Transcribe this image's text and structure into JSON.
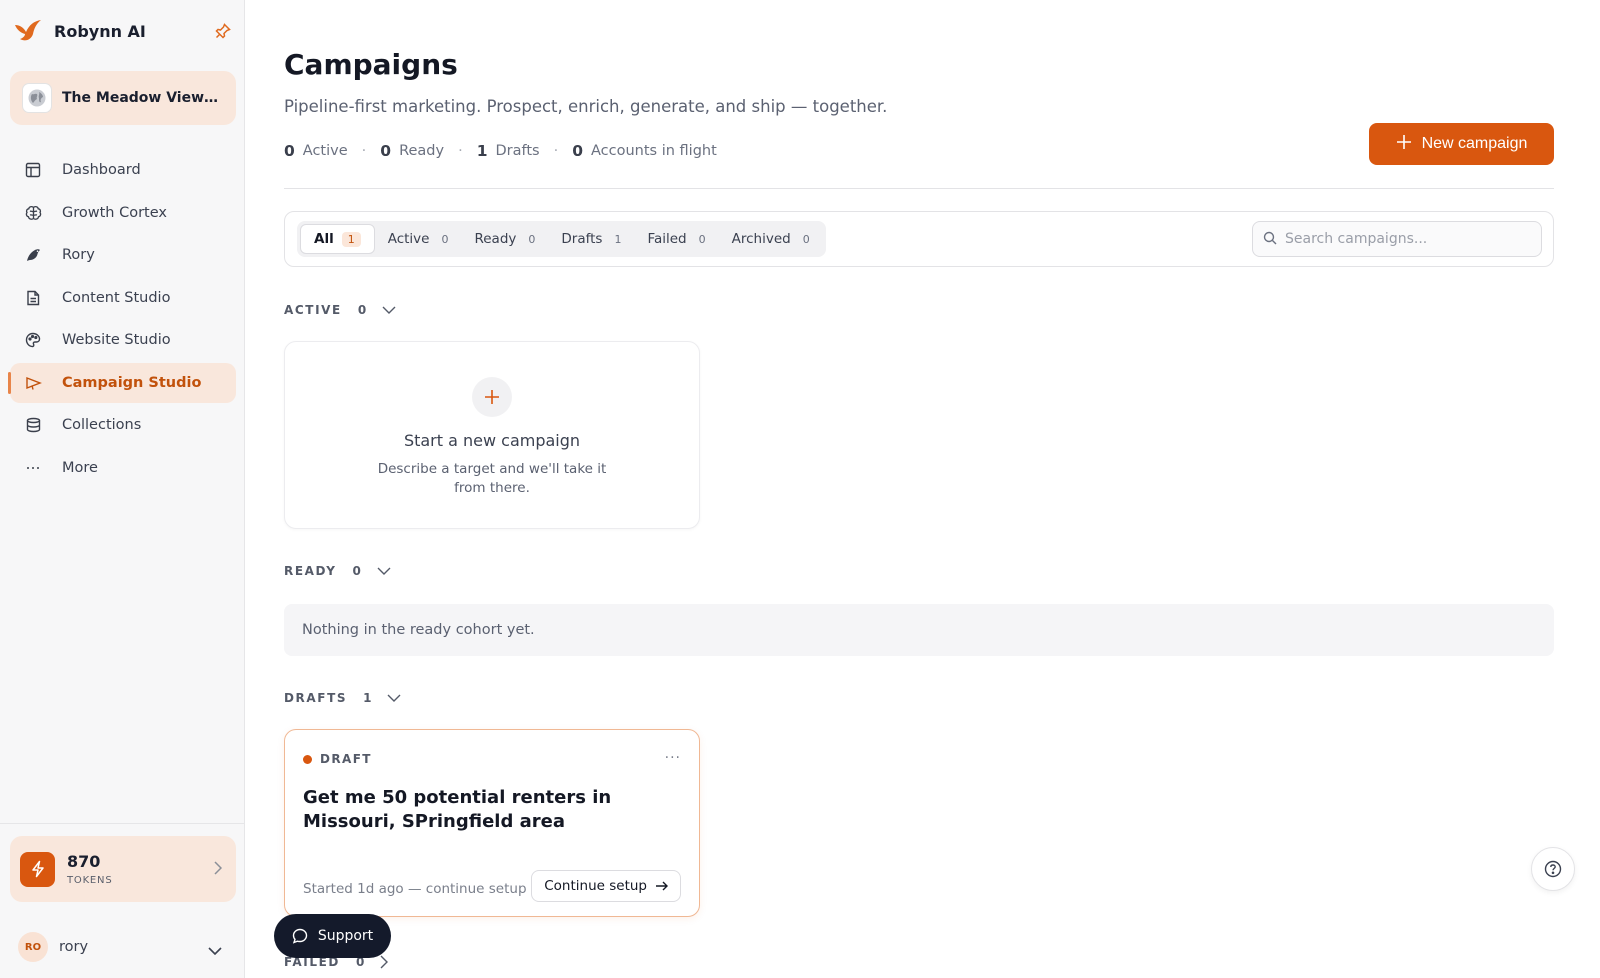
{
  "app": {
    "name": "Robynn AI"
  },
  "workspace": {
    "name": "The Meadow View A..."
  },
  "nav": [
    {
      "label": "Dashboard",
      "icon": "layout-icon"
    },
    {
      "label": "Growth Cortex",
      "icon": "brain-icon"
    },
    {
      "label": "Rory",
      "icon": "bird-icon"
    },
    {
      "label": "Content Studio",
      "icon": "document-icon"
    },
    {
      "label": "Website Studio",
      "icon": "palette-icon"
    },
    {
      "label": "Campaign Studio",
      "icon": "megaphone-icon",
      "active": true
    },
    {
      "label": "Collections",
      "icon": "database-icon"
    },
    {
      "label": "More",
      "icon": "ellipsis-icon"
    }
  ],
  "tokens": {
    "count": "870",
    "label": "TOKENS"
  },
  "user": {
    "initials": "RO",
    "name": "rory"
  },
  "page": {
    "title": "Campaigns",
    "subtitle": "Pipeline-first marketing. Prospect, enrich, generate, and ship — together."
  },
  "stats": [
    {
      "value": "0",
      "label": "Active"
    },
    {
      "value": "0",
      "label": "Ready"
    },
    {
      "value": "1",
      "label": "Drafts"
    },
    {
      "value": "0",
      "label": "Accounts in flight"
    }
  ],
  "new_campaign_label": "New campaign",
  "filters": [
    {
      "label": "All",
      "count": "1",
      "active": true
    },
    {
      "label": "Active",
      "count": "0"
    },
    {
      "label": "Ready",
      "count": "0"
    },
    {
      "label": "Drafts",
      "count": "1"
    },
    {
      "label": "Failed",
      "count": "0"
    },
    {
      "label": "Archived",
      "count": "0"
    }
  ],
  "search": {
    "placeholder": "Search campaigns..."
  },
  "sections": {
    "active": {
      "label": "ACTIVE",
      "count": "0"
    },
    "ready": {
      "label": "READY",
      "count": "0",
      "empty_text": "Nothing in the ready cohort yet."
    },
    "drafts": {
      "label": "DRAFTS",
      "count": "1"
    },
    "failed": {
      "label": "FAILED",
      "count": "0"
    }
  },
  "new_card": {
    "title": "Start a new campaign",
    "description": "Describe a target and we'll take it from there."
  },
  "draft_card": {
    "status": "DRAFT",
    "title": "Get me 50 potential renters in Missouri, SPringfield area",
    "meta": "Started 1d ago — continue setup",
    "action": "Continue setup"
  },
  "support_label": "Support",
  "colors": {
    "accent": "#d9570f",
    "accent_soft": "#f9e7dc",
    "dark": "#141a2b"
  }
}
